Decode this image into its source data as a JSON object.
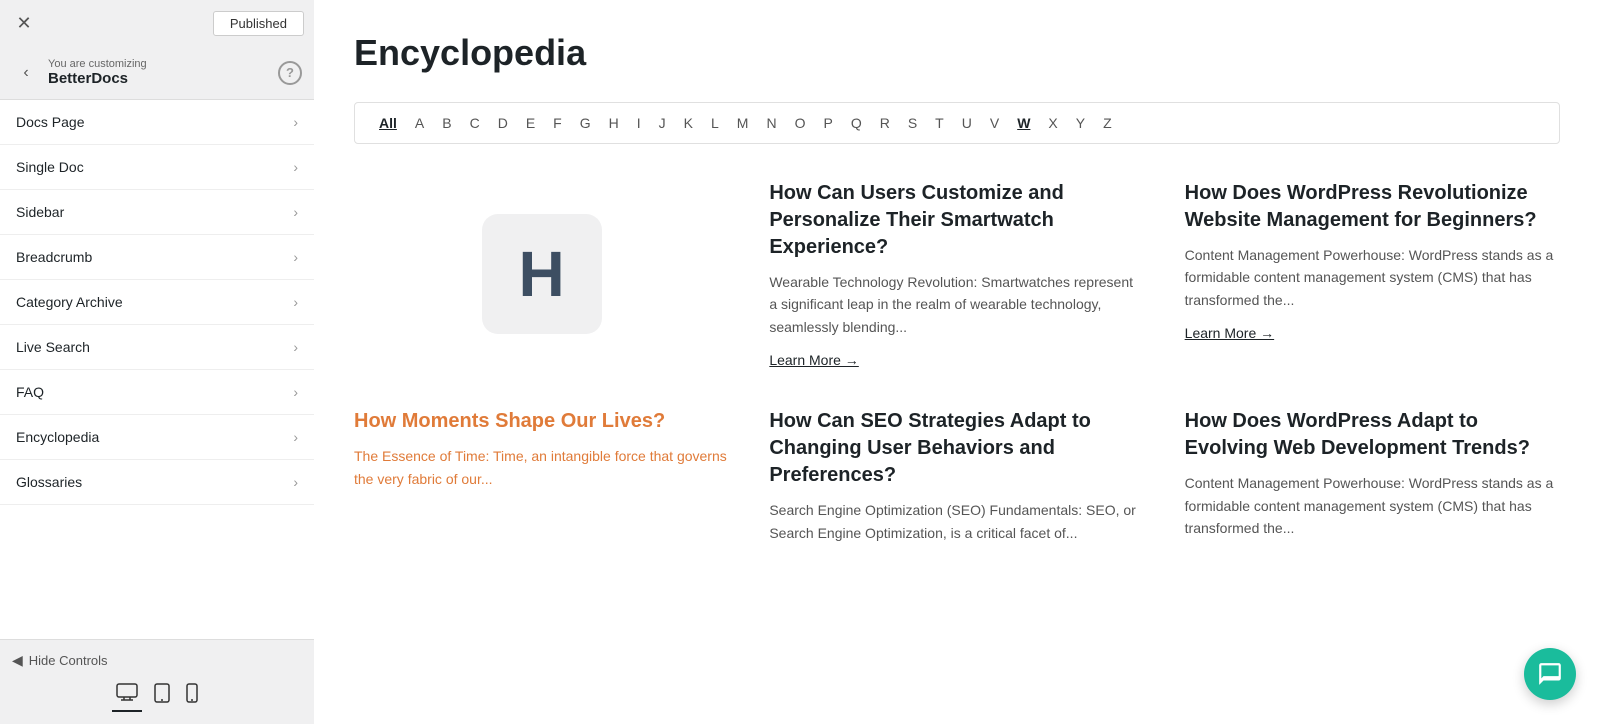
{
  "topbar": {
    "close_icon": "✕",
    "published_label": "Published"
  },
  "sidebar_header": {
    "back_icon": "‹",
    "customizing_label": "You are customizing",
    "customizing_title": "BetterDocs",
    "help_icon": "?"
  },
  "sidebar_menu": {
    "items": [
      {
        "label": "Docs Page"
      },
      {
        "label": "Single Doc"
      },
      {
        "label": "Sidebar"
      },
      {
        "label": "Breadcrumb"
      },
      {
        "label": "Category Archive"
      },
      {
        "label": "Live Search"
      },
      {
        "label": "FAQ"
      },
      {
        "label": "Encyclopedia"
      },
      {
        "label": "Glossaries"
      }
    ]
  },
  "bottom_controls": {
    "hide_controls_label": "Hide Controls",
    "view_desktop_icon": "🖥",
    "view_tablet_icon": "⬜",
    "view_mobile_icon": "📱"
  },
  "main": {
    "page_title": "Encyclopedia",
    "alphabet": [
      "All",
      "A",
      "B",
      "C",
      "D",
      "E",
      "F",
      "G",
      "H",
      "I",
      "J",
      "K",
      "L",
      "M",
      "N",
      "O",
      "P",
      "Q",
      "R",
      "S",
      "T",
      "U",
      "V",
      "W",
      "X",
      "Y",
      "Z"
    ],
    "active_letter": "All",
    "highlighted_letter": "W",
    "letter_display": "H",
    "articles_row1": [
      {
        "type": "letter",
        "letter": "H"
      },
      {
        "type": "article",
        "title": "How Can Users Customize and Personalize Their Smartwatch Experience?",
        "excerpt": "Wearable Technology Revolution: Smartwatches represent a significant leap in the realm of wearable technology, seamlessly blending...",
        "learn_more": "Learn More →"
      },
      {
        "type": "article",
        "title": "How Does WordPress Revolutionize Website Management for Beginners?",
        "excerpt": "Content Management Powerhouse: WordPress stands as a formidable content management system (CMS) that has transformed the...",
        "learn_more": "Learn More →"
      }
    ],
    "articles_row2": [
      {
        "type": "article_orange",
        "title": "How Moments Shape Our Lives?",
        "excerpt": "The Essence of Time: Time, an intangible force that governs the very fabric of our..."
      },
      {
        "type": "article",
        "title": "How Can SEO Strategies Adapt to Changing User Behaviors and Preferences?",
        "excerpt": "Search Engine Optimization (SEO) Fundamentals: SEO, or Search Engine Optimization, is a critical facet of..."
      },
      {
        "type": "article",
        "title": "How Does WordPress Adapt to Evolving Web Development Trends?",
        "excerpt": "Content Management Powerhouse: WordPress stands as a formidable content management system (CMS) that has transformed the..."
      }
    ]
  }
}
